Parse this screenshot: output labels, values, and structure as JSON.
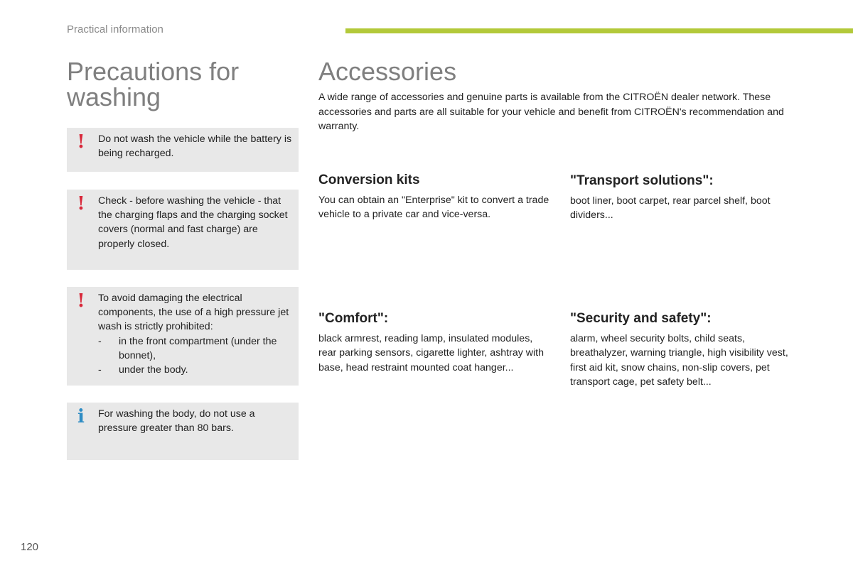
{
  "header": {
    "section_label": "Practical information",
    "accent_color": "#b3c93a"
  },
  "left": {
    "title": "Precautions for washing",
    "notices": [
      {
        "icon": "warning-exclamation-icon",
        "icon_glyph": "!",
        "text": "Do not wash the vehicle while the battery is being recharged."
      },
      {
        "icon": "warning-exclamation-icon",
        "icon_glyph": "!",
        "text": "Check - before washing the vehicle - that the charging flaps and the charging socket covers (normal and fast charge) are properly closed."
      },
      {
        "icon": "warning-exclamation-icon",
        "icon_glyph": "!",
        "text": "To avoid damaging the electrical components, the use of a high pressure jet wash is strictly prohibited:",
        "bullets": [
          {
            "dash": "-",
            "text": "in the front compartment (under the bonnet),"
          },
          {
            "dash": "-",
            "text": "under the body."
          }
        ]
      },
      {
        "icon": "info-icon",
        "icon_glyph": "i",
        "text": "For washing the body, do not use a pressure greater than 80 bars."
      }
    ]
  },
  "right": {
    "title": "Accessories",
    "intro": "A wide range of accessories and genuine parts is available from the CITROËN dealer network. These accessories and parts are all suitable for your vehicle and benefit from CITROËN's recommendation and warranty.",
    "sections": [
      {
        "heading": "Conversion kits",
        "body": "You can obtain an \"Enterprise\" kit to convert a trade vehicle to a private car and vice-versa."
      },
      {
        "heading": "\"Transport solutions\":",
        "body": "boot liner, boot carpet, rear parcel shelf, boot dividers..."
      },
      {
        "heading": "\"Comfort\":",
        "body": "black armrest, reading lamp, insulated modules, rear parking sensors, cigarette lighter, ashtray with base, head restraint mounted coat hanger..."
      },
      {
        "heading": "\"Security and safety\":",
        "body": "alarm, wheel security bolts, child seats, breathalyzer, warning triangle, high visibility vest, first aid kit, snow chains, non-slip covers, pet transport cage, pet safety belt..."
      }
    ]
  },
  "footer": {
    "page_number": "120"
  }
}
